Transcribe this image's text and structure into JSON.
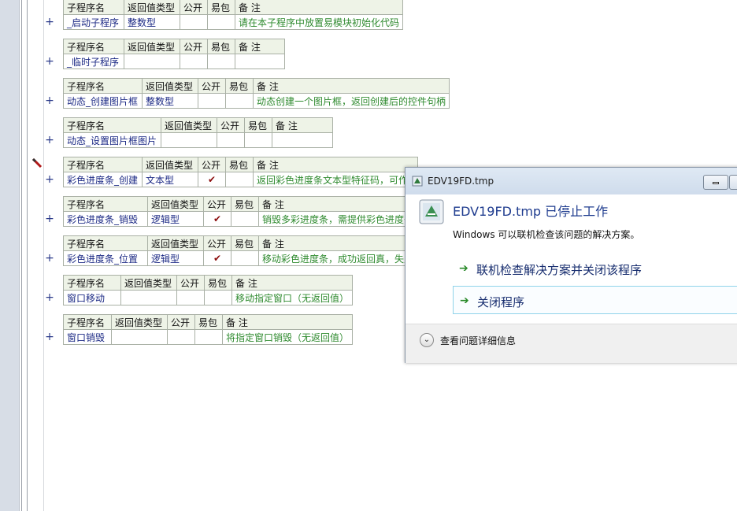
{
  "header_labels": {
    "name": "子程序名",
    "ret": "返回值类型",
    "pub": "公开",
    "pkg": "易包",
    "note": "备 注"
  },
  "plus_sign": "+",
  "check_mark": "✔",
  "subs": [
    {
      "name": "_启动子程序",
      "type": "整数型",
      "public": "",
      "note": "请在本子程序中放置易模块初始化代码"
    },
    {
      "name": "_临时子程序",
      "type": "",
      "public": "",
      "note": ""
    },
    {
      "name": "动态_创建图片框",
      "type": "整数型",
      "public": "",
      "note": "动态创建一个图片框，返回创建后的控件句柄"
    },
    {
      "name": "动态_设置图片框图片",
      "type": "",
      "public": "",
      "note": ""
    },
    {
      "name": "彩色进度条_创建",
      "type": "文本型",
      "public": "✔",
      "note": "返回彩色进度条文本型特征码，可作"
    },
    {
      "name": "彩色进度条_销毁",
      "type": "逻辑型",
      "public": "✔",
      "note": "销毁多彩进度条，需提供彩色进度条"
    },
    {
      "name": "彩色进度条_位置",
      "type": "逻辑型",
      "public": "✔",
      "note": "移动彩色进度条，成功返回真，失败"
    },
    {
      "name": "窗口移动",
      "type": "",
      "public": "",
      "note": "移动指定窗口（无返回值）"
    },
    {
      "name": "窗口销毁",
      "type": "",
      "public": "",
      "note": "将指定窗口销毁（无返回值）"
    }
  ],
  "dialog": {
    "title": "EDV19FD.tmp",
    "heading": "EDV19FD.tmp 已停止工作",
    "subtext": "Windows 可以联机检查该问题的解决方案。",
    "option1": "联机检查解决方案并关闭该程序",
    "option2": "关闭程序",
    "details": "查看问题详细信息"
  },
  "colors": {
    "header_bg": "#eef3e7",
    "name_text": "#1c2a85",
    "note_text": "#2e8a2e",
    "check": "#8b0b0b",
    "dialog_heading": "#1f3c8f"
  }
}
